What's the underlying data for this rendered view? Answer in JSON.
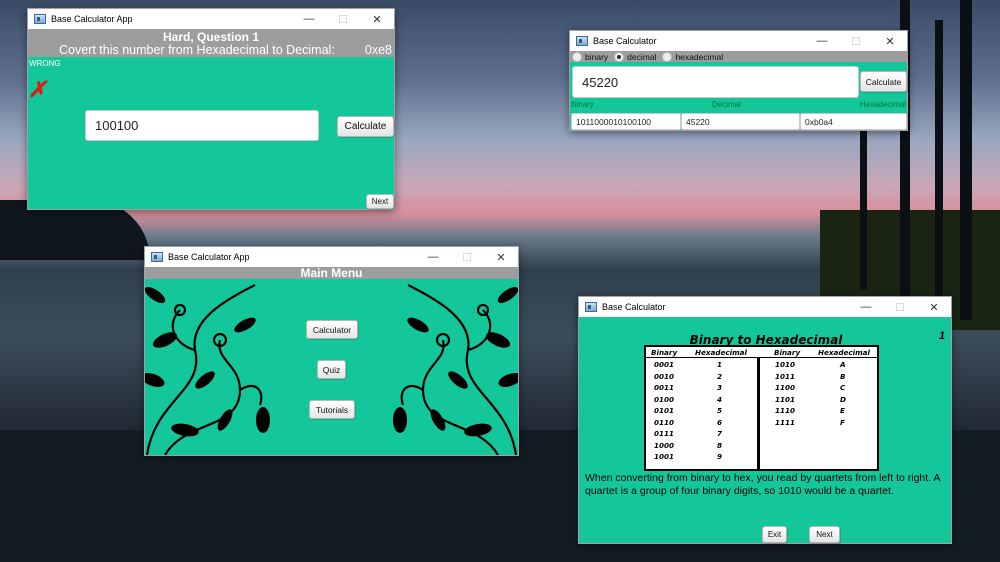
{
  "colors": {
    "accent": "#14c79a",
    "header_gray": "#9d9d9d",
    "wrong_red": "#e01818"
  },
  "window_controls": {
    "minimize": "—",
    "maximize": "☐",
    "close": "✕"
  },
  "quiz": {
    "window_title": "Base Calculator App",
    "header_title": "Hard, Question 1",
    "prompt": "Covert this number from Hexadecimal to Decimal:",
    "number": "0xe8",
    "result_label": "WRONG",
    "result_icon": "red-x-icon",
    "answer_value": "100100",
    "calculate_label": "Calculate",
    "next_label": "Next"
  },
  "calculator": {
    "window_title": "Base Calculator",
    "radios": [
      {
        "label": "binary",
        "selected": false
      },
      {
        "label": "decimal",
        "selected": true
      },
      {
        "label": "hexadecimal",
        "selected": false
      }
    ],
    "input_value": "45220",
    "calculate_label": "Calculate",
    "labels": {
      "binary": "Binary",
      "decimal": "Decimal",
      "hexadecimal": "Hexadecimal"
    },
    "results": {
      "binary": "1011000010100100",
      "decimal": "45220",
      "hexadecimal": "0xb0a4"
    }
  },
  "menu": {
    "window_title": "Base Calculator App",
    "header_title": "Main Menu",
    "buttons": {
      "calculator": "Calculator",
      "quiz": "Quiz",
      "tutorials": "Tutorials"
    }
  },
  "tutorial": {
    "window_title": "Base Calculator",
    "page_number": "1",
    "title": "Binary to Hexadecimal",
    "headers": {
      "binary": "Binary",
      "hex": "Hexadecimal"
    },
    "left_rows": [
      [
        "0001",
        "1"
      ],
      [
        "0010",
        "2"
      ],
      [
        "0011",
        "3"
      ],
      [
        "0100",
        "4"
      ],
      [
        "0101",
        "5"
      ],
      [
        "0110",
        "6"
      ],
      [
        "0111",
        "7"
      ],
      [
        "1000",
        "8"
      ],
      [
        "1001",
        "9"
      ]
    ],
    "right_rows": [
      [
        "1010",
        "A"
      ],
      [
        "1011",
        "B"
      ],
      [
        "1100",
        "C"
      ],
      [
        "1101",
        "D"
      ],
      [
        "1110",
        "E"
      ],
      [
        "1111",
        "F"
      ]
    ],
    "description": "When converting from binary to hex, you read by quartets from left to right. A quartet is a group of four binary digits, so 1010 would be a quartet.",
    "exit_label": "Exit",
    "next_label": "Next"
  }
}
